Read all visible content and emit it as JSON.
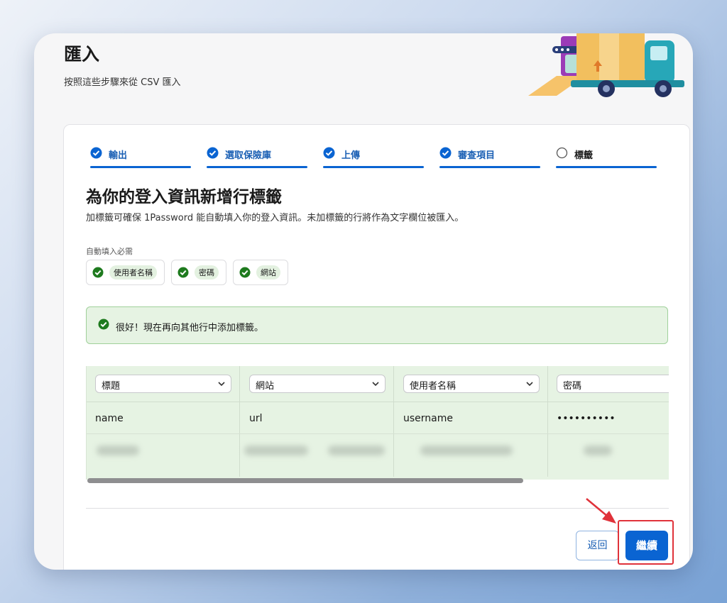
{
  "page": {
    "title": "匯入",
    "subtitle": "按照這些步驟來從 CSV 匯入"
  },
  "steps": [
    {
      "label": "輸出",
      "state": "done"
    },
    {
      "label": "選取保險庫",
      "state": "done"
    },
    {
      "label": "上傳",
      "state": "done"
    },
    {
      "label": "審查項目",
      "state": "done"
    },
    {
      "label": "標籤",
      "state": "current"
    }
  ],
  "section": {
    "title": "為你的登入資訊新增行標籤",
    "description": "加標籤可確保 1Password 能自動填入你的登入資訊。未加標籤的行將作為文字欄位被匯入。",
    "required_label": "自動填入必需",
    "required_chips": [
      "使用者名稱",
      "密碼",
      "網站"
    ]
  },
  "banner": {
    "message": "很好！現在再向其他行中添加標籤。"
  },
  "table": {
    "columns": [
      {
        "select_value": "標題",
        "sample": "name"
      },
      {
        "select_value": "網站",
        "sample": "url"
      },
      {
        "select_value": "使用者名稱",
        "sample": "username"
      },
      {
        "select_value": "密碼",
        "sample": "••••••••••"
      }
    ]
  },
  "actions": {
    "back_label": "返回",
    "continue_label": "繼續"
  },
  "colors": {
    "accent": "#0a64d2",
    "success_bg": "#e6f3e3",
    "check_green": "#1e7a1e",
    "annotation_red": "#e0323a"
  }
}
